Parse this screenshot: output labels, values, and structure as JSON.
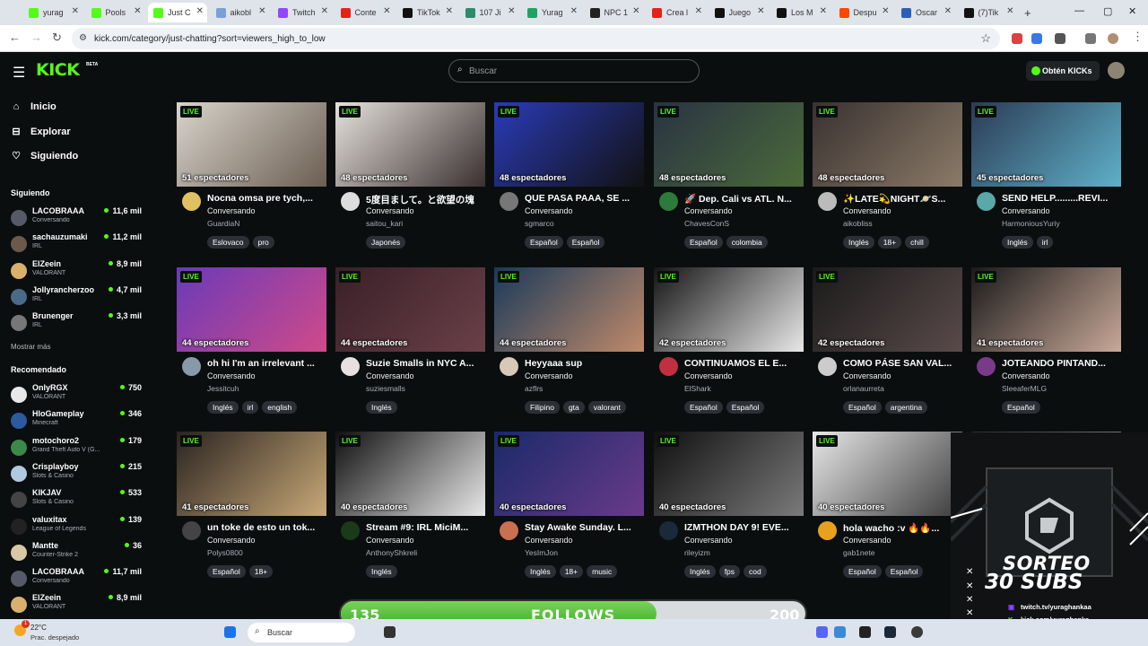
{
  "browser": {
    "tabs": [
      {
        "title": "yurag",
        "icon": "kick-favicon",
        "color": "#53fc18"
      },
      {
        "title": "Pools",
        "icon": "kick-favicon",
        "color": "#53fc18"
      },
      {
        "title": "Just C",
        "icon": "kick-favicon",
        "color": "#53fc18",
        "active": true
      },
      {
        "title": "aikobl",
        "icon": "generic-favicon",
        "color": "#7aa0d8"
      },
      {
        "title": "Twitch",
        "icon": "twitch-favicon",
        "color": "#9146ff"
      },
      {
        "title": "Conte",
        "icon": "youtube-favicon",
        "color": "#e62117"
      },
      {
        "title": "TikTok",
        "icon": "tiktok-favicon",
        "color": "#111111"
      },
      {
        "title": "107 Ji",
        "icon": "generic-favicon",
        "color": "#2a8c6a"
      },
      {
        "title": "Yurag",
        "icon": "sheets-favicon",
        "color": "#1ea362"
      },
      {
        "title": "NPC 1",
        "icon": "notion-favicon",
        "color": "#222222"
      },
      {
        "title": "Crea l",
        "icon": "youtube-favicon",
        "color": "#e62117"
      },
      {
        "title": "Juego",
        "icon": "tiktok-favicon",
        "color": "#111111"
      },
      {
        "title": "Los M",
        "icon": "tiktok-favicon",
        "color": "#111111"
      },
      {
        "title": "Despu",
        "icon": "reddit-favicon",
        "color": "#ff4500"
      },
      {
        "title": "Oscar",
        "icon": "generic-favicon",
        "color": "#2b5fb3"
      },
      {
        "title": "(7)Tik",
        "icon": "tiktok-favicon",
        "color": "#111111"
      }
    ],
    "new_tab": "+",
    "url": "kick.com/category/just-chatting?sort=viewers_high_to_low"
  },
  "header": {
    "logo": "KICK",
    "logo_badge": "BETA",
    "search_placeholder": "Buscar",
    "get_kicks": "Obtén KICKs"
  },
  "sidebar": {
    "nav": [
      {
        "label": "Inicio",
        "icon": "home-icon",
        "glyph": "⌂"
      },
      {
        "label": "Explorar",
        "icon": "compass-icon",
        "glyph": "⊟"
      },
      {
        "label": "Siguiendo",
        "icon": "heart-icon",
        "glyph": "♡"
      }
    ],
    "following_title": "Siguiendo",
    "following": [
      {
        "name": "LACOBRAAA",
        "category": "Conversando",
        "viewers": "11,6 mil",
        "color": "#555a66"
      },
      {
        "name": "sachauzumaki",
        "category": "IRL",
        "viewers": "11,2 mil",
        "color": "#6b5a4a"
      },
      {
        "name": "ElZeein",
        "category": "VALORANT",
        "viewers": "8,9 mil",
        "color": "#d9b06c"
      },
      {
        "name": "Jollyrancherzoo",
        "category": "IRL",
        "viewers": "4,7 mil",
        "color": "#4a6a8a"
      },
      {
        "name": "Brunenger",
        "category": "IRL",
        "viewers": "3,3 mil",
        "color": "#777777"
      }
    ],
    "show_more": "Mostrar más",
    "recommended_title": "Recomendado",
    "recommended": [
      {
        "name": "OnlyRGX",
        "category": "VALORANT",
        "viewers": "750",
        "color": "#e8e8e8"
      },
      {
        "name": "HloGameplay",
        "category": "Minecraft",
        "viewers": "346",
        "color": "#2c5aa0"
      },
      {
        "name": "motochoro2",
        "category": "Grand Theft Auto V (G...",
        "viewers": "179",
        "color": "#3c8a4a"
      },
      {
        "name": "Crisplayboy",
        "category": "Slots & Casino",
        "viewers": "215",
        "color": "#b0c8e0"
      },
      {
        "name": "KIKJAV",
        "category": "Slots & Casino",
        "viewers": "533",
        "color": "#444444"
      },
      {
        "name": "valuxitax",
        "category": "League of Legends",
        "viewers": "139",
        "color": "#222222"
      },
      {
        "name": "Mantte",
        "category": "Counter-Strike 2",
        "viewers": "36",
        "color": "#d8c8a8"
      },
      {
        "name": "LACOBRAAA",
        "category": "Conversando",
        "viewers": "11,7 mil",
        "color": "#555a66"
      },
      {
        "name": "ElZeein",
        "category": "VALORANT",
        "viewers": "8,9 mil",
        "color": "#d9b06c"
      }
    ]
  },
  "streams": [
    {
      "viewers": "51 espectadores",
      "title": "Nocna omsa pre tych,...",
      "category": "Conversando",
      "streamer": "GuardiaN",
      "tags": [
        "Eslovaco",
        "pro"
      ],
      "thumb": [
        "#d9d4cc",
        "#6b5e52"
      ],
      "avatar": "#e0c060"
    },
    {
      "viewers": "48 espectadores",
      "title": "5度目まして。と欲望の塊",
      "category": "Conversando",
      "streamer": "saitou_kari",
      "tags": [
        "Japonés"
      ],
      "thumb": [
        "#e6e2dc",
        "#3a3030"
      ],
      "avatar": "#dddddd"
    },
    {
      "viewers": "48 espectadores",
      "title": "QUE PASA PAAA, SE ...",
      "category": "Conversando",
      "streamer": "sgmarco",
      "tags": [
        "Español",
        "Español"
      ],
      "thumb": [
        "#2a3bb8",
        "#111111"
      ],
      "avatar": "#777777"
    },
    {
      "viewers": "48 espectadores",
      "title": "🚀 Dep. Cali vs ATL. N...",
      "category": "Conversando",
      "streamer": "ChavesConS",
      "tags": [
        "Español",
        "colombia"
      ],
      "thumb": [
        "#2a3342",
        "#4a6a3a"
      ],
      "avatar": "#2e7a3a"
    },
    {
      "viewers": "48 espectadores",
      "title": "✨LATE💫NIGHT🪐S...",
      "category": "Conversando",
      "streamer": "aikobliss",
      "tags": [
        "Inglés",
        "18+",
        "chill"
      ],
      "thumb": [
        "#3a3230",
        "#8a7a68"
      ],
      "avatar": "#bbbbbb"
    },
    {
      "viewers": "45 espectadores",
      "title": "SEND HELP.........REVI...",
      "category": "Conversando",
      "streamer": "HarmoniousYuriy",
      "tags": [
        "Inglés",
        "irl"
      ],
      "thumb": [
        "#2c3b55",
        "#5fb0c8"
      ],
      "avatar": "#5aa8a8"
    },
    {
      "viewers": "44 espectadores",
      "title": "oh hi I'm an irrelevant ...",
      "category": "Conversando",
      "streamer": "Jessitcuh",
      "tags": [
        "Inglés",
        "irl",
        "english"
      ],
      "thumb": [
        "#6a3ab8",
        "#d04a8a"
      ],
      "avatar": "#8899aa"
    },
    {
      "viewers": "44 espectadores",
      "title": "Suzie Smalls in NYC A...",
      "category": "Conversando",
      "streamer": "suziesmalls",
      "tags": [
        "Inglés"
      ],
      "thumb": [
        "#3a2028",
        "#6a4048"
      ],
      "avatar": "#e8e0e0"
    },
    {
      "viewers": "44 espectadores",
      "title": "Heyyaaa sup",
      "category": "Conversando",
      "streamer": "azflrs",
      "tags": [
        "Filipino",
        "gta",
        "valorant"
      ],
      "thumb": [
        "#1a3a5a",
        "#c08a6a"
      ],
      "avatar": "#d8c8b8"
    },
    {
      "viewers": "42 espectadores",
      "title": "CONTINUAMOS EL E...",
      "category": "Conversando",
      "streamer": "ElShark",
      "tags": [
        "Español",
        "Español"
      ],
      "thumb": [
        "#151515",
        "#e8e8e8"
      ],
      "avatar": "#c03040"
    },
    {
      "viewers": "42 espectadores",
      "title": "COMO PÁSE SAN VAL...",
      "category": "Conversando",
      "streamer": "orlanaurreta",
      "tags": [
        "Español",
        "argentina"
      ],
      "thumb": [
        "#1a1a1a",
        "#5a4a4a"
      ],
      "avatar": "#cccccc"
    },
    {
      "viewers": "41 espectadores",
      "title": "JOTEANDO PINTAND...",
      "category": "Conversando",
      "streamer": "SleeaferMLG",
      "tags": [
        "Español"
      ],
      "thumb": [
        "#1a1a1a",
        "#c8a898"
      ],
      "avatar": "#7a3a8a"
    },
    {
      "viewers": "41 espectadores",
      "title": "un toke de esto un tok...",
      "category": "Conversando",
      "streamer": "Polys0800",
      "tags": [
        "Español",
        "18+"
      ],
      "thumb": [
        "#2a2420",
        "#c8a878"
      ],
      "avatar": "#444444"
    },
    {
      "viewers": "40 espectadores",
      "title": "Stream #9: IRL MiciM...",
      "category": "Conversando",
      "streamer": "AnthonyShkreli",
      "tags": [
        "Inglés"
      ],
      "thumb": [
        "#101010",
        "#e8e8e8"
      ],
      "avatar": "#1a3a1a"
    },
    {
      "viewers": "40 espectadores",
      "title": "Stay Awake Sunday. L...",
      "category": "Conversando",
      "streamer": "YesImJon",
      "tags": [
        "Inglés",
        "18+",
        "music"
      ],
      "thumb": [
        "#1a2a6a",
        "#6a3a8a"
      ],
      "avatar": "#c87050"
    },
    {
      "viewers": "40 espectadores",
      "title": "IZMTHON DAY 9! EVE...",
      "category": "Conversando",
      "streamer": "rileyizm",
      "tags": [
        "Inglés",
        "fps",
        "cod"
      ],
      "thumb": [
        "#101010",
        "#7a7a7a"
      ],
      "avatar": "#1a2a3a"
    },
    {
      "viewers": "40 espectadores",
      "title": "hola wacho :v 🔥🔥...",
      "category": "Conversando",
      "streamer": "gab1nete",
      "tags": [
        "Español",
        "Español"
      ],
      "thumb": [
        "#e8e8e8",
        "#3a3a3a"
      ],
      "avatar": "#e8a020"
    },
    {
      "viewers": "",
      "title": "",
      "category": "",
      "streamer": "",
      "tags": [],
      "thumb": [
        "#2a2a2a",
        "#9a9a9a"
      ],
      "avatar": "#222222"
    }
  ],
  "live_label": "LIVE",
  "overlay": {
    "line1": "SORTEO",
    "line2": "30 SUBS",
    "twitch": "twitch.tv/yuraghankaa",
    "kick": "kick.com/yuraghanka"
  },
  "follows": {
    "current": "135",
    "label": "FOLLOWS",
    "goal": "200",
    "progress": 0.68
  },
  "taskbar": {
    "temperature": "22°C",
    "weather": "Prac. despejado",
    "search": "Buscar",
    "notification_count": "1"
  }
}
